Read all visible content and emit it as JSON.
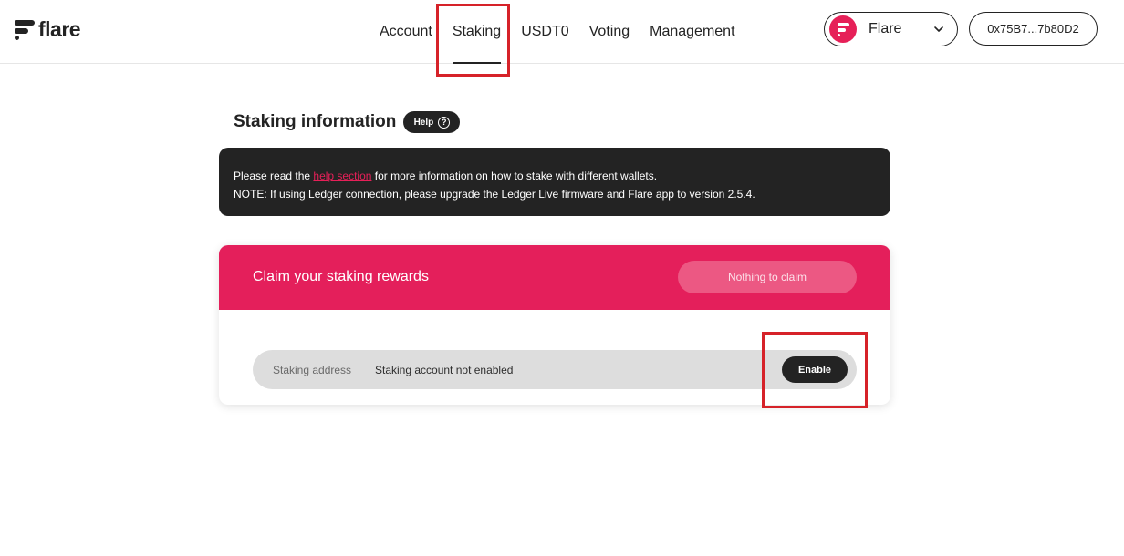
{
  "header": {
    "logo_text": "flare",
    "nav": [
      {
        "label": "Account",
        "active": false
      },
      {
        "label": "Staking",
        "active": true
      },
      {
        "label": "USDT0",
        "active": false
      },
      {
        "label": "Voting",
        "active": false
      },
      {
        "label": "Management",
        "active": false
      }
    ],
    "network": {
      "selected": "Flare",
      "icon": "flare-network-icon"
    },
    "wallet_address": "0x75B7...7b80D2"
  },
  "page": {
    "title": "Staking information",
    "help_label": "Help",
    "help_icon_glyph": "?"
  },
  "info": {
    "line1_before": "Please read the ",
    "line1_link": "help section",
    "line1_after": " for more information on how to stake with different wallets.",
    "line2": "NOTE: If using Ledger connection, please upgrade the Ledger Live firmware and Flare app to version 2.5.4."
  },
  "rewards": {
    "title": "Claim your staking rewards",
    "claim_button": "Nothing to claim",
    "address_label": "Staking address",
    "address_value": "Staking account not enabled",
    "enable_button": "Enable"
  },
  "colors": {
    "accent": "#e41f5b",
    "dark": "#232323",
    "highlight": "#d62229"
  }
}
